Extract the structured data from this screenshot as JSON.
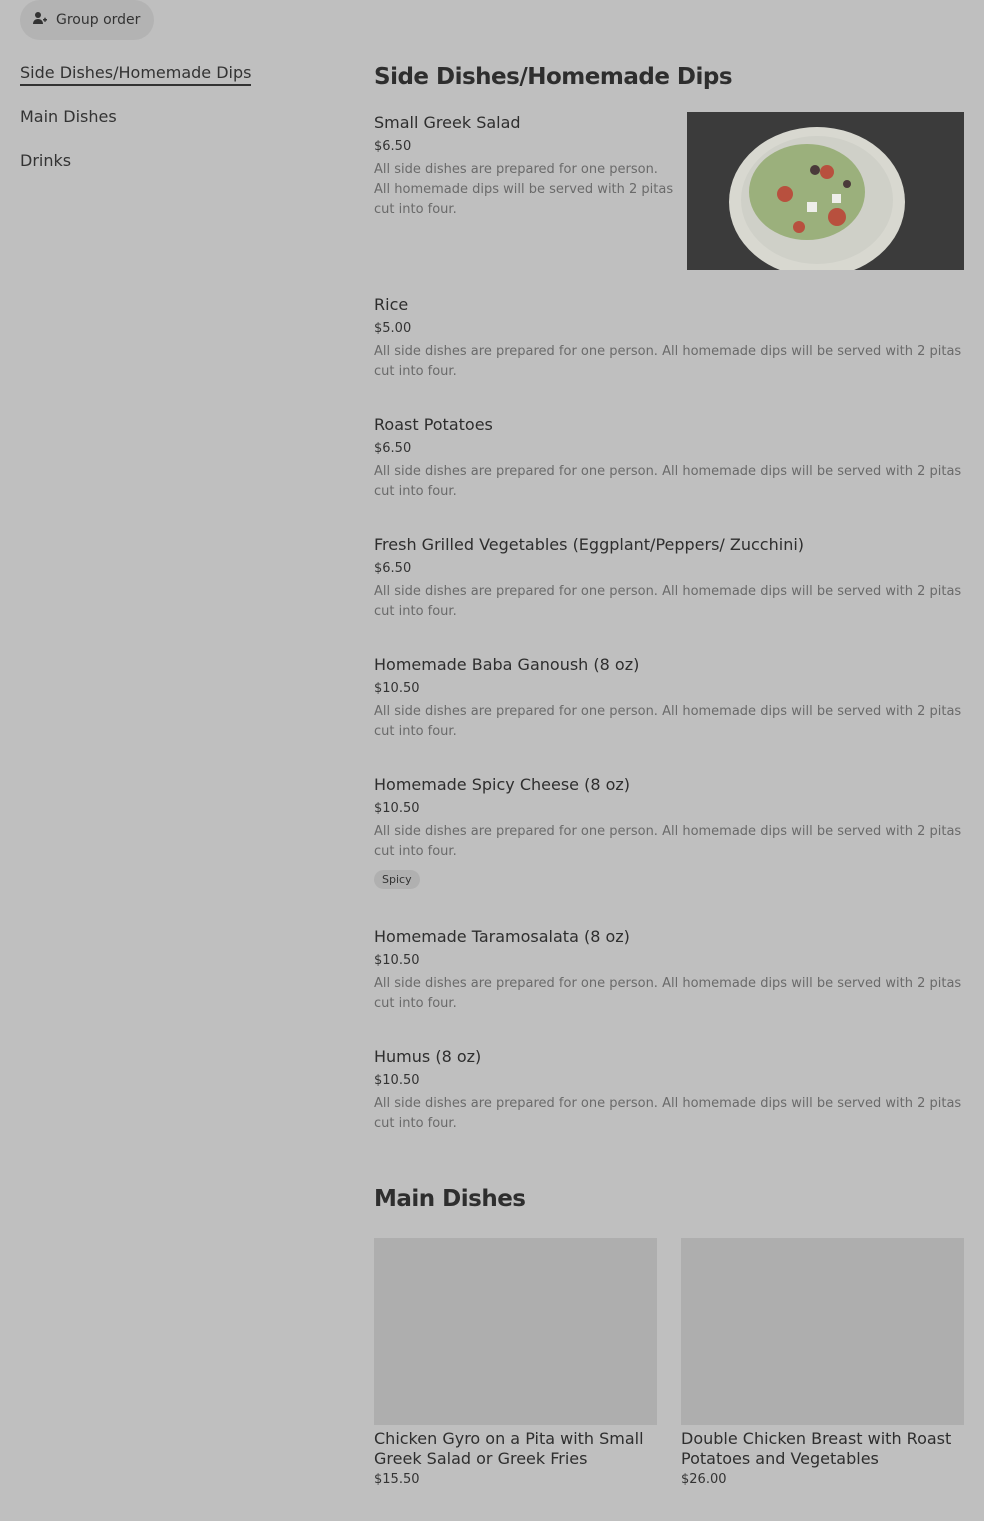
{
  "header": {
    "group_order_label": "Group order"
  },
  "nav": {
    "items": [
      {
        "label": "Side Dishes/Homemade Dips",
        "active": true
      },
      {
        "label": "Main Dishes"
      },
      {
        "label": "Drinks"
      }
    ]
  },
  "sections": {
    "side": {
      "title": "Side Dishes/Homemade Dips",
      "items": [
        {
          "name": "Small Greek Salad",
          "price": "$6.50",
          "desc": "All side dishes are prepared for one person. All homemade dips will be served with 2 pitas cut into four."
        },
        {
          "name": "Rice",
          "price": "$5.00",
          "desc": "All side dishes are prepared for one person. All homemade dips will be served with 2 pitas cut into four."
        },
        {
          "name": "Roast Potatoes",
          "price": "$6.50",
          "desc": "All side dishes are prepared for one person. All homemade dips will be served with 2 pitas cut into four."
        },
        {
          "name": "Fresh Grilled Vegetables (Eggplant/Peppers/ Zucchini)",
          "price": "$6.50",
          "desc": "All side dishes are prepared for one person. All homemade dips will be served with 2 pitas cut into four."
        },
        {
          "name": "Homemade Baba Ganoush (8 oz)",
          "price": "$10.50",
          "desc": "All side dishes are prepared for one person. All homemade dips will be served with 2 pitas cut into four."
        },
        {
          "name": "Homemade Spicy Cheese (8 oz)",
          "price": "$10.50",
          "desc": "All side dishes are prepared for one person. All homemade dips will be served with 2 pitas cut into four.",
          "tag": "Spicy"
        },
        {
          "name": "Homemade Taramosalata (8 oz)",
          "price": "$10.50",
          "desc": "All side dishes are prepared for one person. All homemade dips will be served with 2 pitas cut into four."
        },
        {
          "name": "Humus (8 oz)",
          "price": "$10.50",
          "desc": "All side dishes are prepared for one person. All homemade dips will be served with 2 pitas cut into four."
        }
      ]
    },
    "main": {
      "title": "Main Dishes",
      "items": [
        {
          "name": "Chicken Gyro on a Pita with Small Greek Salad or Greek Fries",
          "price": "$15.50"
        },
        {
          "name": "Double Chicken Breast with Roast Potatoes and Vegetables",
          "price": "$26.00"
        }
      ]
    }
  }
}
